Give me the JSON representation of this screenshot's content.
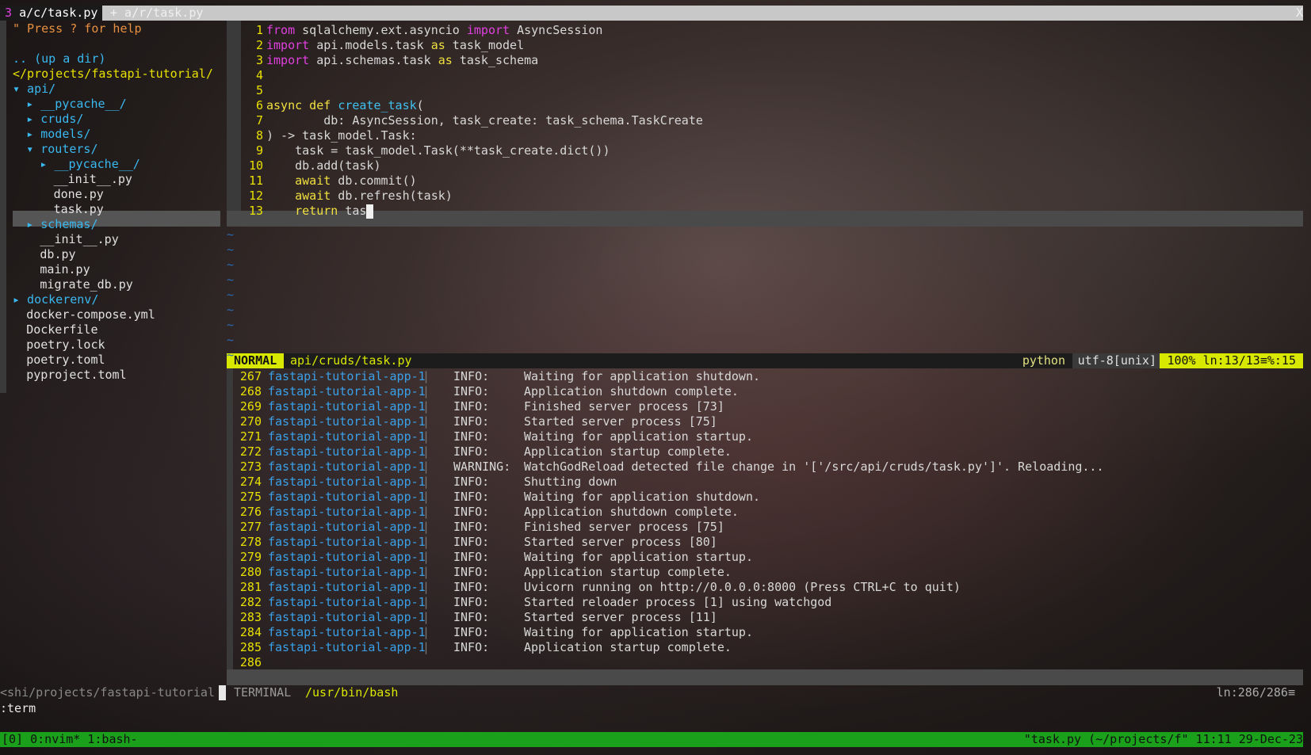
{
  "tabs": [
    {
      "num": "3",
      "label": "a/c/task.py"
    },
    {
      "label": "+ a/r/task.py"
    }
  ],
  "tab_close": "X",
  "tree": {
    "help": "\" Press ? for help",
    "up": ".. (up a dir)",
    "root": "</projects/fastapi-tutorial/",
    "items": [
      {
        "text": "▾ api/",
        "kind": "dir",
        "indent": 0
      },
      {
        "text": "▸ __pycache__/",
        "kind": "dir",
        "indent": 2
      },
      {
        "text": "▸ cruds/",
        "kind": "dir",
        "indent": 2
      },
      {
        "text": "▸ models/",
        "kind": "dir",
        "indent": 2
      },
      {
        "text": "▾ routers/",
        "kind": "dir",
        "indent": 2
      },
      {
        "text": "▸ __pycache__/",
        "kind": "dir",
        "indent": 4
      },
      {
        "text": "__init__.py",
        "kind": "file",
        "indent": 6
      },
      {
        "text": "done.py",
        "kind": "file",
        "indent": 6
      },
      {
        "text": "task.py",
        "kind": "file",
        "indent": 6
      },
      {
        "text": "▸ schemas/",
        "kind": "dir",
        "indent": 2
      },
      {
        "text": "__init__.py",
        "kind": "file",
        "indent": 4
      },
      {
        "text": "db.py",
        "kind": "file",
        "indent": 4
      },
      {
        "text": "main.py",
        "kind": "file",
        "indent": 4
      },
      {
        "text": "migrate_db.py",
        "kind": "file",
        "indent": 4
      },
      {
        "text": "▸ dockerenv/",
        "kind": "dir",
        "indent": 0
      },
      {
        "text": "docker-compose.yml",
        "kind": "file",
        "indent": 2
      },
      {
        "text": "Dockerfile",
        "kind": "file",
        "indent": 2
      },
      {
        "text": "poetry.lock",
        "kind": "file",
        "indent": 2
      },
      {
        "text": "poetry.toml",
        "kind": "file",
        "indent": 2
      },
      {
        "text": "pyproject.toml",
        "kind": "file",
        "indent": 2
      }
    ]
  },
  "code": {
    "lines": [
      {
        "n": "1",
        "parts": [
          [
            "imp",
            "from"
          ],
          [
            "t",
            " sqlalchemy.ext.asyncio "
          ],
          [
            "imp",
            "import"
          ],
          [
            "t",
            " AsyncSession"
          ]
        ]
      },
      {
        "n": "2",
        "parts": [
          [
            "imp",
            "import"
          ],
          [
            "t",
            " api.models.task "
          ],
          [
            "kw",
            "as"
          ],
          [
            "t",
            " task_model"
          ]
        ]
      },
      {
        "n": "3",
        "parts": [
          [
            "imp",
            "import"
          ],
          [
            "t",
            " api.schemas.task "
          ],
          [
            "kw",
            "as"
          ],
          [
            "t",
            " task_schema"
          ]
        ]
      },
      {
        "n": "4",
        "parts": []
      },
      {
        "n": "5",
        "parts": []
      },
      {
        "n": "6",
        "parts": [
          [
            "kw",
            "async def"
          ],
          [
            "t",
            " "
          ],
          [
            "fn",
            "create_task"
          ],
          [
            "t",
            "("
          ]
        ]
      },
      {
        "n": "7",
        "parts": [
          [
            "t",
            "        db: AsyncSession, task_create: task_schema.TaskCreate"
          ]
        ]
      },
      {
        "n": "8",
        "parts": [
          [
            "t",
            ") -> task_model.Task:"
          ]
        ]
      },
      {
        "n": "9",
        "parts": [
          [
            "t",
            "    task = task_model.Task(**task_create.dict())"
          ]
        ]
      },
      {
        "n": "10",
        "parts": [
          [
            "t",
            "    db.add(task)"
          ]
        ]
      },
      {
        "n": "11",
        "parts": [
          [
            "t",
            "    "
          ],
          [
            "kw",
            "await"
          ],
          [
            "t",
            " db.commit()"
          ]
        ]
      },
      {
        "n": "12",
        "parts": [
          [
            "t",
            "    "
          ],
          [
            "kw",
            "await"
          ],
          [
            "t",
            " db.refresh(task)"
          ]
        ]
      },
      {
        "n": "13",
        "parts": [
          [
            "t",
            "    "
          ],
          [
            "kw",
            "return"
          ],
          [
            "t",
            " tas"
          ]
        ]
      }
    ]
  },
  "status": {
    "mode": "NORMAL",
    "file": "api/cruds/task.py",
    "filetype": "python",
    "encoding": "utf-8[unix]",
    "position": "100% ln:13/13≡%:15"
  },
  "terminal": {
    "app": "fastapi-tutorial-app-1",
    "sep": "|",
    "lines": [
      {
        "n": "267",
        "level": "INFO:",
        "msg": "Waiting for application shutdown."
      },
      {
        "n": "268",
        "level": "INFO:",
        "msg": "Application shutdown complete."
      },
      {
        "n": "269",
        "level": "INFO:",
        "msg": "Finished server process [73]"
      },
      {
        "n": "270",
        "level": "INFO:",
        "msg": "Started server process [75]"
      },
      {
        "n": "271",
        "level": "INFO:",
        "msg": "Waiting for application startup."
      },
      {
        "n": "272",
        "level": "INFO:",
        "msg": "Application startup complete."
      },
      {
        "n": "273",
        "level": "WARNING:",
        "msg": "WatchGodReload detected file change in '['/src/api/cruds/task.py']'. Reloading..."
      },
      {
        "n": "274",
        "level": "INFO:",
        "msg": "Shutting down"
      },
      {
        "n": "275",
        "level": "INFO:",
        "msg": "Waiting for application shutdown."
      },
      {
        "n": "276",
        "level": "INFO:",
        "msg": "Application shutdown complete."
      },
      {
        "n": "277",
        "level": "INFO:",
        "msg": "Finished server process [75]"
      },
      {
        "n": "278",
        "level": "INFO:",
        "msg": "Started server process [80]"
      },
      {
        "n": "279",
        "level": "INFO:",
        "msg": "Waiting for application startup."
      },
      {
        "n": "280",
        "level": "INFO:",
        "msg": "Application startup complete."
      },
      {
        "n": "281",
        "level": "INFO:",
        "msg": "Uvicorn running on http://0.0.0.0:8000 (Press CTRL+C to quit)"
      },
      {
        "n": "282",
        "level": "INFO:",
        "msg": "Started reloader process [1] using watchgod"
      },
      {
        "n": "283",
        "level": "INFO:",
        "msg": "Started server process [11]"
      },
      {
        "n": "284",
        "level": "INFO:",
        "msg": "Waiting for application startup."
      },
      {
        "n": "285",
        "level": "INFO:",
        "msg": "Application startup complete."
      }
    ],
    "last_line": "286"
  },
  "term_status": {
    "left": "<shi/projects/fastapi-tutorial",
    "label": "TERMINAL",
    "path": "/usr/bin/bash",
    "pos": "ln:286/286≡"
  },
  "cmdline": ":term",
  "tmux": {
    "left": "[0] 0:nvim* 1:bash-",
    "right": "\"task.py (~/projects/f\" 11:11 29-Dec-23"
  },
  "colors": {
    "accent": "#d8e800",
    "tmux_bar": "#1aa01a",
    "dir": "#3ab8f0",
    "keyword": "#f0e040",
    "import": "#e040e0"
  }
}
